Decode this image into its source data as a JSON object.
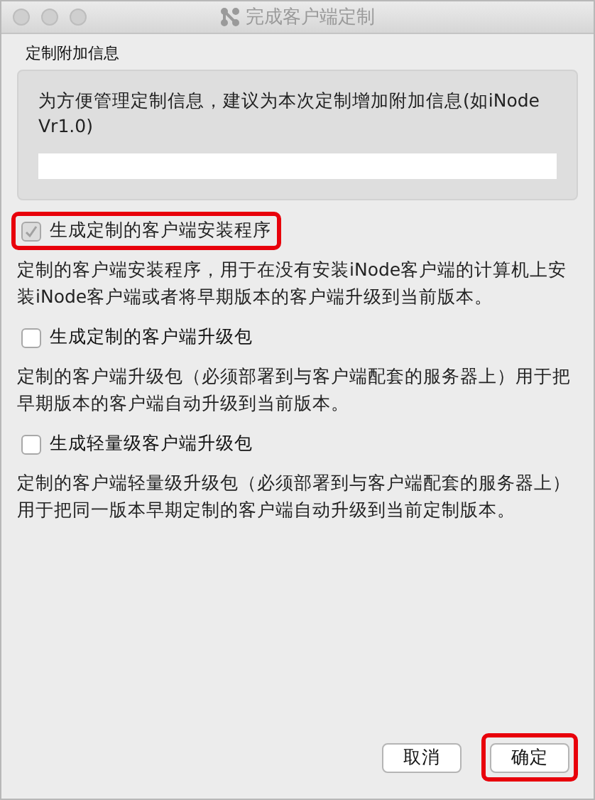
{
  "window": {
    "title": "完成客户端定制"
  },
  "extra_info": {
    "label": "定制附加信息",
    "hint": "为方便管理定制信息，建议为本次定制增加附加信息(如iNode Vr1.0)"
  },
  "options": [
    {
      "label": "生成定制的客户端安装程序",
      "checked": true,
      "disabled": true,
      "highlighted": true,
      "description": "定制的客户端安装程序，用于在没有安装iNode客户端的计算机上安装iNode客户端或者将早期版本的客户端升级到当前版本。"
    },
    {
      "label": "生成定制的客户端升级包",
      "checked": false,
      "disabled": false,
      "highlighted": false,
      "description": "定制的客户端升级包（必须部署到与客户端配套的服务器上）用于把早期版本的客户端自动升级到当前版本。"
    },
    {
      "label": "生成轻量级客户端升级包",
      "checked": false,
      "disabled": false,
      "highlighted": false,
      "description": "定制的客户端轻量级升级包（必须部署到与客户端配套的服务器上）用于把同一版本早期定制的客户端自动升级到当前定制版本。"
    }
  ],
  "buttons": [
    {
      "label": "取消",
      "highlighted": false
    },
    {
      "label": "确定",
      "highlighted": true
    }
  ]
}
